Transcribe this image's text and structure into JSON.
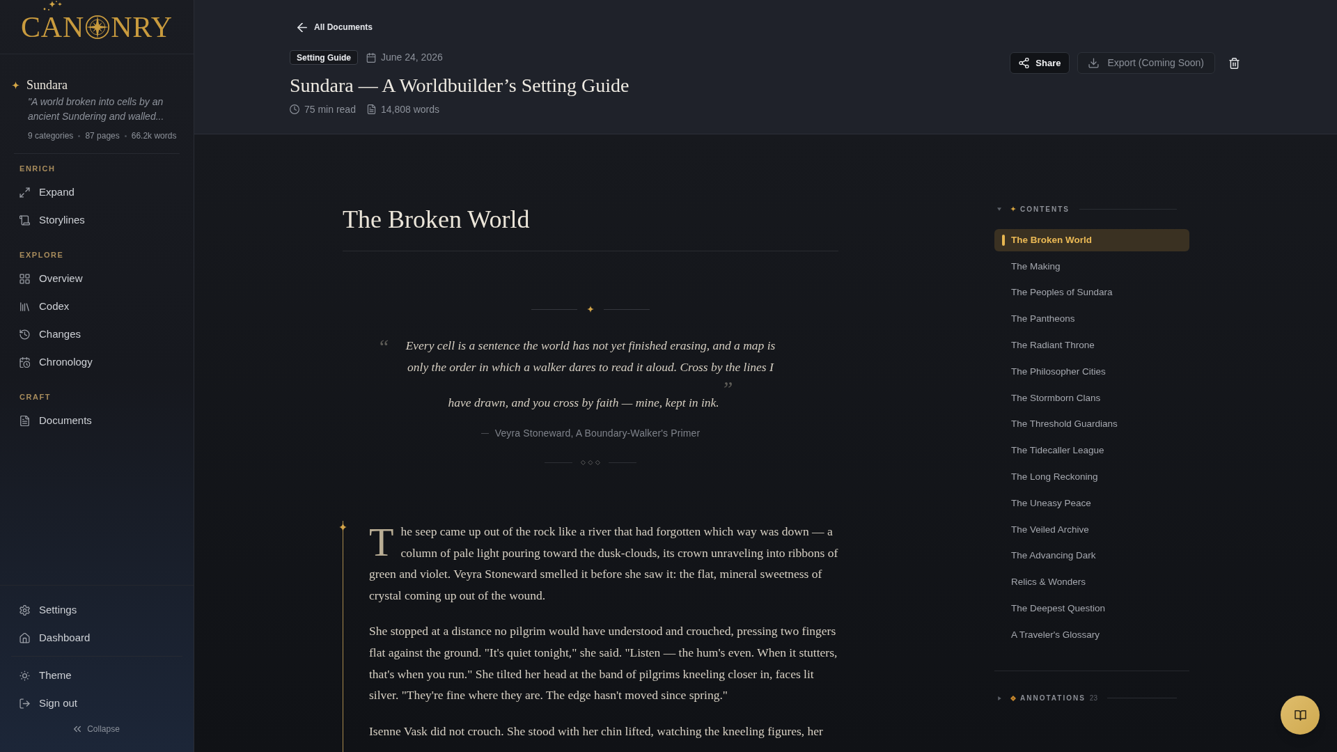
{
  "sidebar": {
    "logo": {
      "text_before_mark": "CAN",
      "text_after_mark": "NRY"
    },
    "world": {
      "name": "Sundara",
      "tagline": "\"A world broken into cells by an ancient Sundering and walled...",
      "stats": [
        "9 categories",
        "87 pages",
        "66.2k words"
      ]
    },
    "sections": [
      {
        "heading": "ENRICH",
        "items": [
          {
            "label": "Expand"
          },
          {
            "label": "Storylines"
          }
        ]
      },
      {
        "heading": "EXPLORE",
        "items": [
          {
            "label": "Overview"
          },
          {
            "label": "Codex"
          },
          {
            "label": "Changes"
          },
          {
            "label": "Chronology"
          }
        ]
      },
      {
        "heading": "CRAFT",
        "items": [
          {
            "label": "Documents"
          }
        ]
      }
    ],
    "footer_groups": [
      [
        {
          "label": "Settings"
        },
        {
          "label": "Dashboard"
        }
      ],
      [
        {
          "label": "Theme"
        },
        {
          "label": "Sign out"
        }
      ]
    ],
    "collapse_label": "Collapse"
  },
  "header": {
    "back_link": "All Documents",
    "badge": "Setting Guide",
    "date": "June 24, 2026",
    "title": "Sundara — A Worldbuilder’s Setting Guide",
    "read_time": "75 min read",
    "word_count": "14,808 words",
    "actions": [
      {
        "label": "Share",
        "disabled": false
      },
      {
        "label": "Export (Coming Soon)",
        "disabled": true
      }
    ]
  },
  "article": {
    "heading": "The Broken World",
    "epigraph": {
      "open_mark": "“",
      "text": "Every cell is a sentence the world has not yet finished erasing, and a map is only the order in which a walker dares to read it aloud. Cross by the lines I have drawn, and you cross by faith — mine, kept in ink.",
      "close_mark": "”",
      "attribution": "Veyra Stoneward, A Boundary-Walker's Primer"
    },
    "paragraphs": [
      "The seep came up out of the rock like a river that had forgotten which way was down — a column of pale light pouring toward the dusk-clouds, its crown unraveling into ribbons of green and violet. Veyra Stoneward smelled it before she saw it: the flat, mineral sweetness of crystal coming up out of the wound.",
      "She stopped at a distance no pilgrim would have understood and crouched, pressing two fingers flat against the ground. \"It's quiet tonight,\" she said. \"Listen — the hum's even. When it stutters, that's when you run.\" She tilted her head at the band of pilgrims kneeling closer in, faces lit silver. \"They're fine where they are. The edge hasn't moved since spring.\"",
      "Isenne Vask did not crouch. She stood with her chin lifted, watching the kneeling figures, her"
    ]
  },
  "outline": {
    "sections": [
      {
        "title": "CONTENTS",
        "expanded": true,
        "items": [
          {
            "label": "The Broken World",
            "selected": true
          },
          {
            "label": "The Making",
            "selected": false
          },
          {
            "label": "The Peoples of Sundara",
            "selected": false
          },
          {
            "label": "The Pantheons",
            "selected": false
          },
          {
            "label": "The Radiant Throne",
            "selected": false
          },
          {
            "label": "The Philosopher Cities",
            "selected": false
          },
          {
            "label": "The Stormborn Clans",
            "selected": false
          },
          {
            "label": "The Threshold Guardians",
            "selected": false
          },
          {
            "label": "The Tidecaller League",
            "selected": false
          },
          {
            "label": "The Long Reckoning",
            "selected": false
          },
          {
            "label": "The Uneasy Peace",
            "selected": false
          },
          {
            "label": "The Veiled Archive",
            "selected": false
          },
          {
            "label": "The Advancing Dark",
            "selected": false
          },
          {
            "label": "Relics & Wonders",
            "selected": false
          },
          {
            "label": "The Deepest Question",
            "selected": false
          },
          {
            "label": "A Traveler's Glossary",
            "selected": false
          }
        ]
      },
      {
        "title": "ANNOTATIONS",
        "expanded": false,
        "count": "23"
      }
    ]
  }
}
